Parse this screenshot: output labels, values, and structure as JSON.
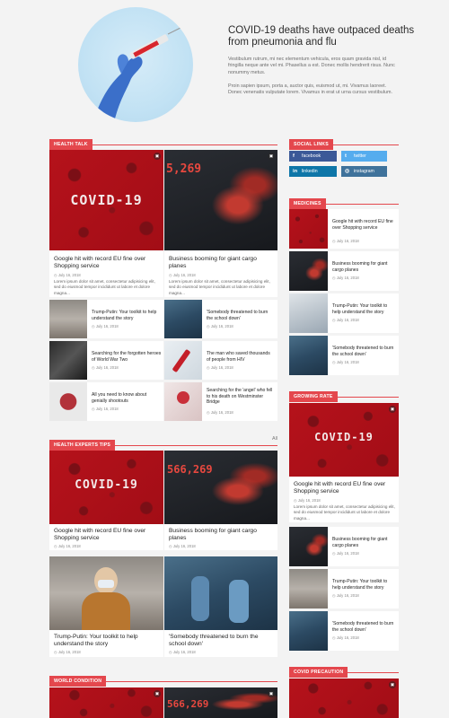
{
  "hero": {
    "title": "COVID-19 deaths have outpaced deaths from pneumonia and flu",
    "paragraph1": "Vestibulum rutrum, mi nec elementum vehicula, eros quam gravida nisl, id fringilla neque ante vel mi. Phasellus a est. Donec mollis hendrerit risus. Nunc nonummy metus.",
    "paragraph2": "Proin sapien ipsum, porta a, auctor quis, euismod ut, mi. Vivamus laoreet. Donec venenatis vulputate lorem. Vivamus in erat ut urna cursus vestibulum."
  },
  "health_talk": {
    "heading": "Health Talk",
    "featured": [
      {
        "title": "Google hit with record EU fine over Shopping service",
        "date": "July 16, 2018",
        "excerpt": "Lorem ipsum dolor sit amet, consectetur adipisicing elit, sed do eiusmod tempor incididunt ut labore et dolore magna...",
        "image_text": "COVID-19"
      },
      {
        "title": "Business booming for giant cargo planes",
        "date": "July 16, 2018",
        "excerpt": "Lorem ipsum dolor sit amet, consectetur adipisicing elit, sed do eiusmod tempor incididunt ut labore et dolore magna...",
        "image_text": "5,269"
      }
    ],
    "list": [
      {
        "title": "Trump-Putin: Your toolkit to help understand the story",
        "date": "July 16, 2018"
      },
      {
        "title": "'Somebody threatened to burn the school down'",
        "date": "July 16, 2018"
      },
      {
        "title": "Searching for the forgotten heroes of World War Two",
        "date": "July 16, 2018"
      },
      {
        "title": "The man who saved thousands of people from HIV",
        "date": "July 16, 2018"
      },
      {
        "title": "All you need to know about genially shootouts",
        "date": "July 16, 2018"
      },
      {
        "title": "Searching for the 'angel' who fell to his death on Westminster Bridge",
        "date": "July 16, 2018"
      }
    ]
  },
  "health_experts": {
    "heading": "Health Experts Tips",
    "more": "All",
    "items": [
      {
        "title": "Google hit with record EU fine over Shopping service",
        "date": "July 16, 2018",
        "image_text": "COVID-19"
      },
      {
        "title": "Business booming for giant cargo planes",
        "date": "July 16, 2018",
        "image_text": "566,269"
      },
      {
        "title": "Trump-Putin: Your toolkit to help understand the story",
        "date": "July 16, 2018"
      },
      {
        "title": "'Somebody threatened to burn the school down'",
        "date": "July 16, 2018"
      }
    ]
  },
  "world_condition": {
    "heading": "World Condition",
    "image_text": "566,269"
  },
  "sidebar": {
    "social": {
      "heading": "Social Links",
      "buttons": [
        {
          "label": "facebook",
          "icon": "f",
          "color": "#3b5998"
        },
        {
          "label": "twitter",
          "icon": "t",
          "color": "#55acee"
        },
        {
          "label": "linkedin",
          "icon": "in",
          "color": "#0e76a8"
        },
        {
          "label": "instagram",
          "icon": "◎",
          "color": "#3f729b"
        }
      ]
    },
    "medicines": {
      "heading": "Medicines",
      "items": [
        {
          "title": "Google hit with record EU fine over Shopping service",
          "date": "July 16, 2018"
        },
        {
          "title": "Business booming for giant cargo planes",
          "date": "July 16, 2018"
        },
        {
          "title": "Trump-Putin: Your toolkit to help understand the story",
          "date": "July 16, 2018"
        },
        {
          "title": "'Somebody threatened to burn the school down'",
          "date": "July 16, 2018"
        }
      ]
    },
    "growing_rate": {
      "heading": "Growing Rate",
      "featured": {
        "title": "Google hit with record EU fine over Shopping service",
        "date": "July 16, 2018",
        "excerpt": "Lorem ipsum dolor sit amet, consectetur adipisicing elit, sed do eiusmod tempor incididunt ut labore et dolore magna...",
        "image_text": "COVID-19"
      },
      "items": [
        {
          "title": "Business booming for giant cargo planes",
          "date": "July 16, 2018"
        },
        {
          "title": "Trump-Putin: Your toolkit to help understand the story",
          "date": "July 16, 2018"
        },
        {
          "title": "'Somebody threatened to burn the school down'",
          "date": "July 16, 2018"
        }
      ]
    },
    "covid_precaution": {
      "heading": "Covid Precaution"
    }
  },
  "colors": {
    "accent": "#e4474d",
    "background": "#f3f3f3"
  }
}
